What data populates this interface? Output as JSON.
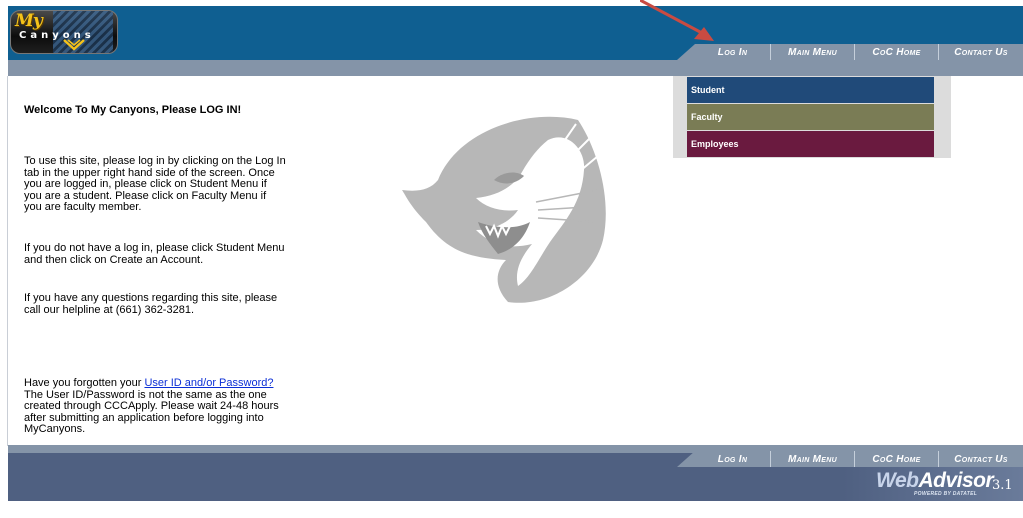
{
  "header": {
    "logo_top": "My",
    "logo_name": "Canyons",
    "accent_color": "#0f5f91",
    "nav_tab_color": "#8494a8"
  },
  "nav": [
    {
      "label": "Log In"
    },
    {
      "label": "Main Menu"
    },
    {
      "label": "CoC Home"
    },
    {
      "label": "Contact Us"
    }
  ],
  "side_menu": [
    {
      "label": "Student",
      "color": "#204a79"
    },
    {
      "label": "Faculty",
      "color": "#7a7c55"
    },
    {
      "label": "Employees",
      "color": "#6a1a3f"
    }
  ],
  "content": {
    "welcome": "Welcome To My Canyons, Please LOG IN!",
    "p1": "To use this site, please log in by clicking on the Log In tab in the upper right hand side of the screen. Once you are logged in, please click on Student Menu if you are a student. Please click on Faculty Menu if you are faculty member.",
    "p2": "If you do not have a log in, please click Student Menu and then click on Create an Account.",
    "p3": "If you have any questions regarding this site, please call our helpline at (661) 362-3281.",
    "p4_prefix": "Have you forgotten your ",
    "p4_link": "User ID and/or Password?",
    "p4_suffix": " The User ID/Password is not the same as the one created through CCCApply. Please wait 24-48 hours after submitting an application before logging into MyCanyons."
  },
  "footer": {
    "brand_web": "Web",
    "brand_advisor": "Advisor",
    "version": "3.1",
    "powered": "POWERED BY DATATEL"
  },
  "annotation": {
    "arrow_color": "#c94b42"
  }
}
